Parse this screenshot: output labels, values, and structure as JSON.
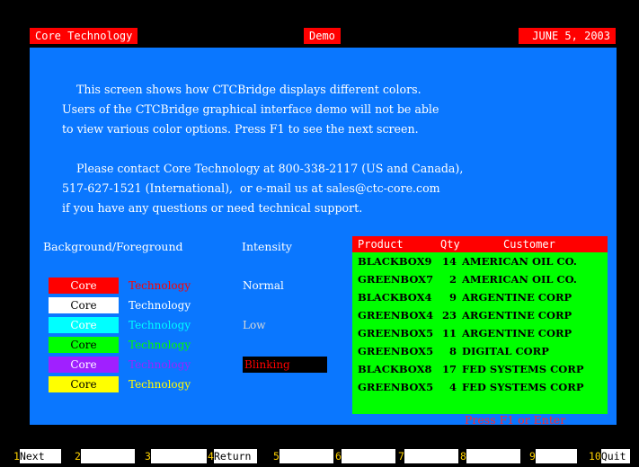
{
  "header": {
    "left": "Core Technology",
    "center": "Demo",
    "right": "JUNE 5, 2003"
  },
  "description": {
    "line1": "    This screen shows how CTCBridge displays different colors.",
    "line2": "Users of the CTCBridge graphical interface demo will not be able",
    "line3": "to view various color options. Press F1 to see the next screen.",
    "line4": "    Please contact Core Technology at 800-338-2117 (US and Canada),",
    "line5": "517-627-1521 (International),  or e-mail us at sales@ctc-core.com",
    "line6": "if you have any questions or need technical support."
  },
  "colors_demo": {
    "bg_fg_header": "Background/Foreground",
    "intensity_header": "Intensity",
    "rows": [
      {
        "label": "Core",
        "technology": "Technology",
        "bg": "#ff0000",
        "fg": "#ffffff",
        "tech_color": "#ff0000"
      },
      {
        "label": "Core",
        "technology": "Technology",
        "bg": "#ffffff",
        "fg": "#000000",
        "tech_color": "#ffffff"
      },
      {
        "label": "Core",
        "technology": "Technology",
        "bg": "#00ffff",
        "fg": "#ffffff",
        "tech_color": "#00ffff"
      },
      {
        "label": "Core",
        "technology": "Technology",
        "bg": "#00ff00",
        "fg": "#000000",
        "tech_color": "#00ff00"
      },
      {
        "label": "Core",
        "technology": "Technology",
        "bg": "#a020ff",
        "fg": "#ffffff",
        "tech_color": "#a020ff"
      },
      {
        "label": "Core",
        "technology": "Technology",
        "bg": "#ffff00",
        "fg": "#000000",
        "tech_color": "#ffff00"
      }
    ],
    "intensities": {
      "normal": "Normal",
      "low": "Low",
      "blinking": "Blinking"
    }
  },
  "grid": {
    "columns": [
      "Product",
      "Qty",
      "Customer"
    ],
    "rows": [
      {
        "product": "BLACKBOX9",
        "qty": "14",
        "customer": "AMERICAN OIL CO."
      },
      {
        "product": "GREENBOX7",
        "qty": "2",
        "customer": "AMERICAN OIL CO."
      },
      {
        "product": "BLACKBOX4",
        "qty": "9",
        "customer": "ARGENTINE CORP"
      },
      {
        "product": "GREENBOX4",
        "qty": "23",
        "customer": "ARGENTINE CORP"
      },
      {
        "product": "GREENBOX5",
        "qty": "11",
        "customer": "ARGENTINE CORP"
      },
      {
        "product": "GREENBOX5",
        "qty": "8",
        "customer": "DIGITAL CORP"
      },
      {
        "product": "BLACKBOX8",
        "qty": "17",
        "customer": "FED SYSTEMS CORP"
      },
      {
        "product": "GREENBOX5",
        "qty": "4",
        "customer": "FED SYSTEMS CORP"
      }
    ]
  },
  "hint": "Press F1 or Enter",
  "fkeys": [
    {
      "num": "1",
      "label": "Next"
    },
    {
      "num": "2",
      "label": ""
    },
    {
      "num": "3",
      "label": ""
    },
    {
      "num": "4",
      "label": "Return"
    },
    {
      "num": "5",
      "label": ""
    },
    {
      "num": "6",
      "label": ""
    },
    {
      "num": "7",
      "label": ""
    },
    {
      "num": "8",
      "label": ""
    },
    {
      "num": "9",
      "label": ""
    },
    {
      "num": "10",
      "label": "Quit"
    }
  ]
}
